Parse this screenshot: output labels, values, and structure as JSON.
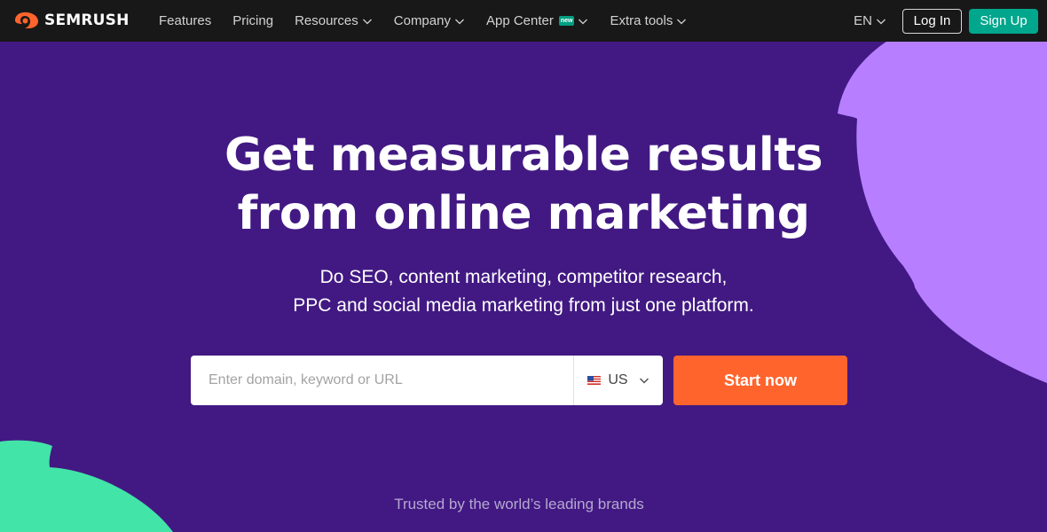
{
  "nav": {
    "logo_text": "SEMRUSH",
    "logo_icon": "semrush-fire-icon",
    "items": [
      {
        "label": "Features",
        "dropdown": false
      },
      {
        "label": "Pricing",
        "dropdown": false
      },
      {
        "label": "Resources",
        "dropdown": true
      },
      {
        "label": "Company",
        "dropdown": true
      },
      {
        "label": "App Center",
        "dropdown": true,
        "badge": "new"
      },
      {
        "label": "Extra tools",
        "dropdown": true
      }
    ],
    "language": "EN",
    "login_label": "Log In",
    "signup_label": "Sign Up"
  },
  "hero": {
    "headline_line1": "Get measurable results",
    "headline_line2": "from online marketing",
    "sub_line1": "Do SEO, content marketing, competitor research,",
    "sub_line2": "PPC and social media marketing from just one platform."
  },
  "search": {
    "placeholder": "Enter domain, keyword or URL",
    "value": "",
    "database_label": "US",
    "database_flag_icon": "us-flag-icon",
    "start_label": "Start now"
  },
  "trusted_text": "Trusted by the world’s leading brands",
  "colors": {
    "nav_background": "#181818",
    "hero_background": "#421983",
    "accent_orange": "#ff642d",
    "signup_green": "#00a78c",
    "decor_violet": "#b77fff",
    "decor_green": "#42e4a8"
  }
}
